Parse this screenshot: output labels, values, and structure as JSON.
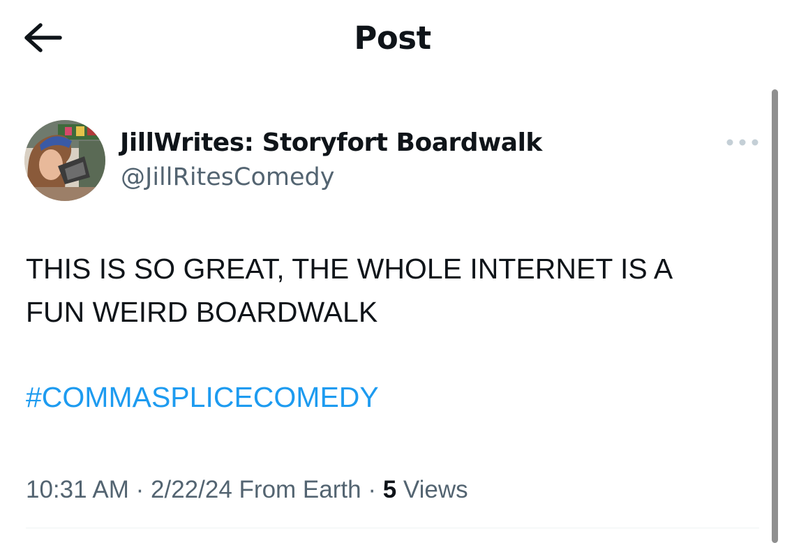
{
  "header": {
    "title": "Post",
    "back_icon": "arrow-left-icon"
  },
  "post": {
    "author": {
      "display_name": "JillWrites: Storyfort Boardwalk",
      "handle": "@JillRitesComedy"
    },
    "text": "THIS IS SO GREAT, THE WHOLE INTERNET IS A\nFUN WEIRD BOARDWALK",
    "hashtag": "#COMMASPLICECOMEDY",
    "time": "10:31 AM",
    "date": "2/22/24",
    "source": "From Earth",
    "separator": "·",
    "views_count": "5",
    "views_label": "Views"
  },
  "colors": {
    "text": "#0f1419",
    "secondary": "#536471",
    "link": "#1d9bf0"
  }
}
